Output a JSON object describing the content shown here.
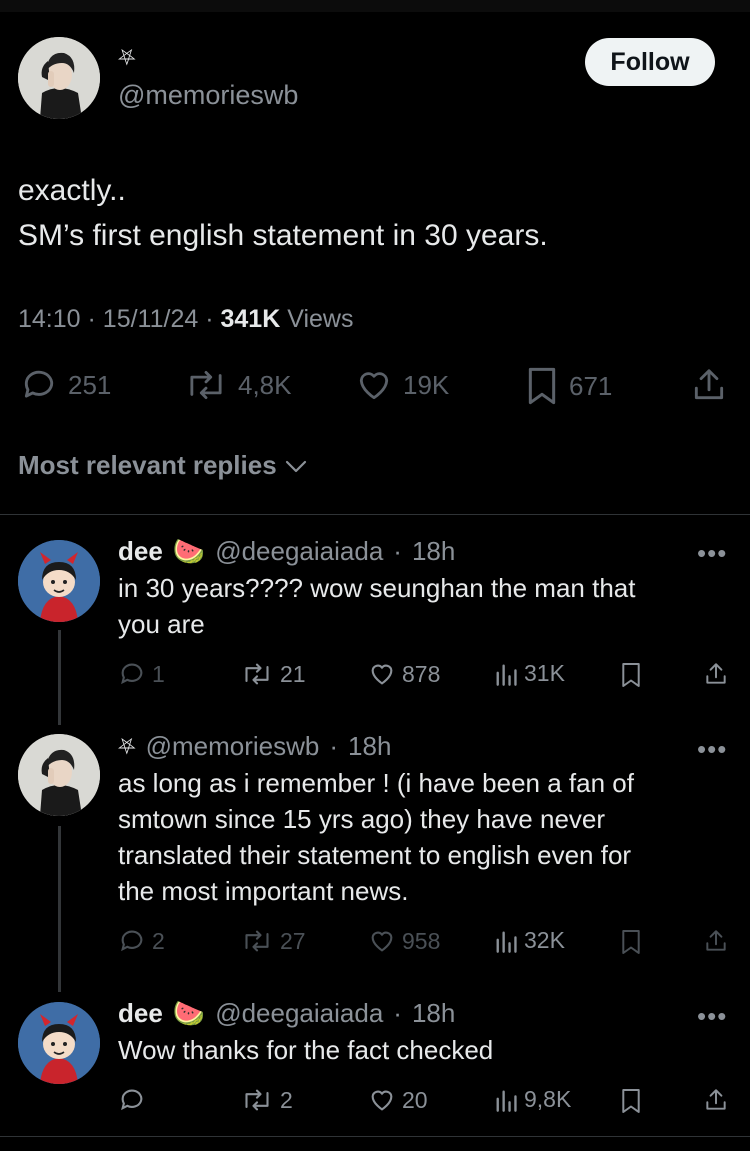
{
  "author": {
    "name_glyph": "⛧",
    "handle": "@memorieswb",
    "follow_label": "Follow"
  },
  "tweet": {
    "lines": [
      "exactly..",
      "SM’s first english statement in 30 years."
    ],
    "time": "14:10",
    "date": "15/11/24",
    "views_count": "341K",
    "views_label": "Views",
    "stats": {
      "replies": "251",
      "reposts": "4,8K",
      "likes": "19K",
      "bookmarks": "671"
    }
  },
  "sort_label": "Most relevant replies",
  "replies": [
    {
      "name": "dee",
      "emoji": "🍉",
      "handle": "@deegaiaiada",
      "age": "18h",
      "lines": [
        "in 30 years???? wow seunghan the man that",
        "you are"
      ],
      "stats": {
        "replies": "1",
        "reposts": "21",
        "likes": "878",
        "views": "31K"
      }
    },
    {
      "name_glyph": "⛧",
      "handle": "@memorieswb",
      "age": "18h",
      "lines": [
        "as long as i remember !  (i have been a fan of",
        "smtown since 15 yrs ago) they have never",
        "translated their statement to english even for",
        "the most important news."
      ],
      "stats": {
        "replies": "2",
        "reposts": "27",
        "likes": "958",
        "views": "32K"
      }
    },
    {
      "name": "dee",
      "emoji": "🍉",
      "handle": "@deegaiaiada",
      "age": "18h",
      "lines": [
        "Wow thanks for the fact checked"
      ],
      "stats": {
        "reposts": "2",
        "likes": "20",
        "views": "9,8K"
      }
    }
  ],
  "icons": [
    "reply-icon",
    "repost-icon",
    "like-icon",
    "bookmark-icon",
    "share-icon",
    "views-icon",
    "more-icon",
    "chevron-down-icon"
  ],
  "colors": {
    "background": "#000000",
    "text": "#e7e9ea",
    "muted": "#8b9198",
    "follow_bg": "#eff3f4"
  }
}
